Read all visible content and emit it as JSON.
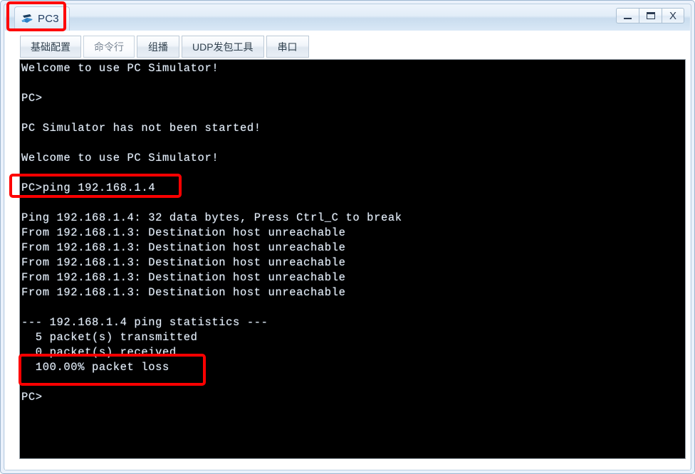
{
  "window": {
    "title": "PC3",
    "icon": "pc-device-icon",
    "controls": [
      {
        "name": "minimize-button",
        "label": "–",
        "glyph": "minimize-icon"
      },
      {
        "name": "maximize-button",
        "label": "▭",
        "glyph": "maximize-icon"
      },
      {
        "name": "close-button",
        "label": "X",
        "glyph": "close-icon"
      }
    ]
  },
  "tabs": [
    {
      "label": "基础配置",
      "name": "tab-basic-config",
      "selected": false
    },
    {
      "label": "命令行",
      "name": "tab-command-line",
      "selected": true
    },
    {
      "label": "组播",
      "name": "tab-multicast",
      "selected": false
    },
    {
      "label": "UDP发包工具",
      "name": "tab-udp-tool",
      "selected": false
    },
    {
      "label": "串口",
      "name": "tab-serial-port",
      "selected": false
    }
  ],
  "terminal": {
    "lines": [
      "Welcome to use PC Simulator!",
      "",
      "PC>",
      "",
      "PC Simulator has not been started!",
      "",
      "Welcome to use PC Simulator!",
      "",
      "PC>ping 192.168.1.4",
      "",
      "Ping 192.168.1.4: 32 data bytes, Press Ctrl_C to break",
      "From 192.168.1.3: Destination host unreachable",
      "From 192.168.1.3: Destination host unreachable",
      "From 192.168.1.3: Destination host unreachable",
      "From 192.168.1.3: Destination host unreachable",
      "From 192.168.1.3: Destination host unreachable",
      "",
      "--- 192.168.1.4 ping statistics ---",
      "  5 packet(s) transmitted",
      "  0 packet(s) received",
      "  100.00% packet loss",
      "",
      "PC>"
    ],
    "command_entered": "ping 192.168.1.4",
    "prompt": "PC>",
    "target_host": "192.168.1.4",
    "source_host": "192.168.1.3",
    "packets_transmitted": "5",
    "packets_received": "0",
    "packet_loss": "100.00%",
    "data_bytes": "32",
    "background_color": "#000000",
    "text_color": "#e8eef5"
  },
  "annotations": {
    "color": "#fe0000",
    "boxes": [
      {
        "name": "annotation-box-title",
        "target": "PC3"
      },
      {
        "name": "annotation-box-command",
        "target": "PC>ping 192.168.1.4"
      },
      {
        "name": "annotation-box-packet-loss",
        "target": "  100.00% packet loss"
      }
    ]
  }
}
